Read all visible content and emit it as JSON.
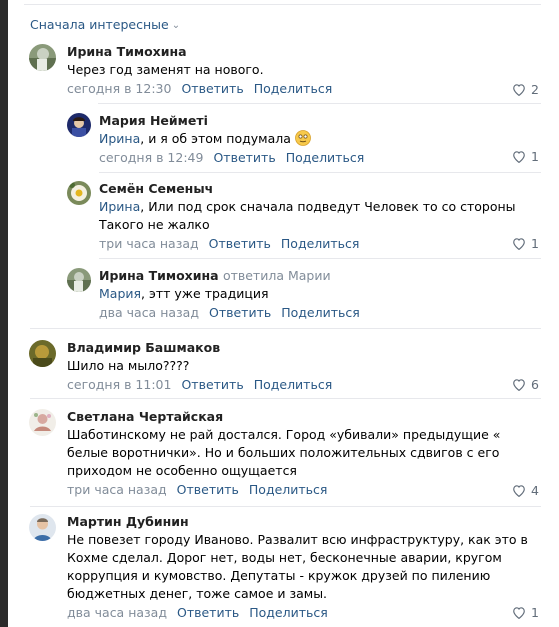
{
  "sort_label": "Сначала интересные",
  "comments": [
    {
      "author": "Ирина Тимохина",
      "text": "Через год заменят на нового.",
      "time": "сегодня в 12:30",
      "reply": "Ответить",
      "share": "Поделиться",
      "likes": "2"
    },
    {
      "author": "Мария Нейметі",
      "mention": "Ирина",
      "text": ", и я об этом подумала",
      "time": "сегодня в 12:49",
      "reply": "Ответить",
      "share": "Поделиться",
      "likes": "1"
    },
    {
      "author": "Семён Семеныч",
      "mention": "Ирина",
      "text": ", Или под срок сначала подведут Человек то со стороны Такого не жалко",
      "time": "три часа назад",
      "reply": "Ответить",
      "share": "Поделиться",
      "likes": "1"
    },
    {
      "author": "Ирина Тимохина",
      "replied_to": "ответила Марии",
      "mention": "Мария",
      "text": ", этт уже традиция",
      "time": "два часа назад",
      "reply": "Ответить",
      "share": "Поделиться",
      "likes": ""
    },
    {
      "author": "Владимир Башмаков",
      "text": "Шило на мыло????",
      "time": "сегодня в 11:01",
      "reply": "Ответить",
      "share": "Поделиться",
      "likes": "6"
    },
    {
      "author": "Светлана Чертайская",
      "text": "Шаботинскому не рай достался. Город «убивали» предыдущие « белые воротнички». Но и больших положительных сдвигов с его приходом не особенно ощущается",
      "time": "три часа назад",
      "reply": "Ответить",
      "share": "Поделиться",
      "likes": "4"
    },
    {
      "author": "Мартин Дубинин",
      "text": "Не повезет городу Иваново. Развалит всю инфраструктуру, как это в Кохме сделал. Дорог нет, воды нет, бесконечные аварии, кругом коррупция и кумовство. Депутаты - кружок друзей по пилению бюджетных денег, тоже самое и замы.",
      "time": "два часа назад",
      "reply": "Ответить",
      "share": "Поделиться",
      "likes": "1"
    }
  ],
  "colors": {
    "link": "#2a5885",
    "meta": "#818c99",
    "separator": "#e7e8ec"
  },
  "icons": [
    "chevron-down-icon",
    "heart-icon",
    "smile-emoji-icon"
  ]
}
